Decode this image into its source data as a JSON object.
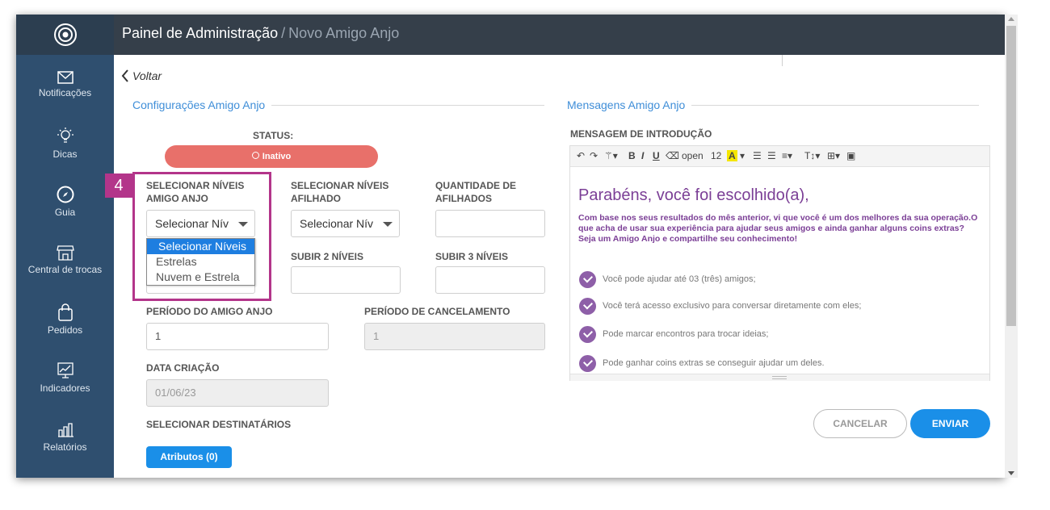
{
  "topbar": {
    "title": "Painel de Administração",
    "separator": "/",
    "subtitle": "Novo Amigo Anjo"
  },
  "sidebar": {
    "items": [
      {
        "label": "Notificações",
        "icon": "envelope-icon"
      },
      {
        "label": "Dicas",
        "icon": "lightbulb-icon"
      },
      {
        "label": "Guia",
        "icon": "compass-icon"
      },
      {
        "label": "Central de trocas",
        "icon": "store-icon"
      },
      {
        "label": "Pedidos",
        "icon": "shopping-bag-icon"
      },
      {
        "label": "Indicadores",
        "icon": "chart-icon"
      },
      {
        "label": "Relatórios",
        "icon": "report-icon"
      }
    ]
  },
  "back": {
    "label": "Voltar"
  },
  "config": {
    "section_title": "Configurações Amigo Anjo",
    "status_label": "STATUS:",
    "status_value": "Inativo",
    "niveis_amigo_label": "SELECIONAR NÍVEIS AMIGO ANJO",
    "niveis_amigo_value": "Selecionar Níveis",
    "niveis_afilhado_label": "SELECIONAR NÍVEIS AFILHADO",
    "niveis_afilhado_value": "Selecionar Níveis",
    "qtd_afilhados_label": "QUANTIDADE DE AFILHADOS",
    "qtd_afilhados_value": "",
    "subir2_label": "SUBIR 2 NÍVEIS",
    "subir3_label": "SUBIR 3 NÍVEIS",
    "periodo_label": "PERÍODO DO AMIGO ANJO",
    "periodo_value": "1",
    "cancelamento_label": "PERÍODO DE CANCELAMENTO",
    "cancelamento_value": "1",
    "data_label": "DATA CRIAÇÃO",
    "data_value": "01/06/23",
    "destinatarios_label": "SELECIONAR DESTINATÁRIOS",
    "atributos_button": "Atributos (0)",
    "dropdown_options": [
      "Selecionar Níveis",
      "Estrelas",
      "Nuvem e Estrela"
    ]
  },
  "annotation": {
    "step": "4",
    "color": "#b3358a"
  },
  "messages": {
    "section_title": "Mensagens Amigo Anjo",
    "intro_label": "MENSAGEM DE INTRODUÇÃO",
    "toolbar": {
      "font": "open",
      "size": "12"
    },
    "heading": "Parabéns, você foi escolhido(a),",
    "paragraph": "Com base nos seus resultados do mês anterior, vi que você é um dos melhores da sua operação.O que acha de usar sua experiência para ajudar seus amigos e ainda ganhar alguns coins extras? Seja um Amigo Anjo e compartilhe seu conhecimento!",
    "bullets": [
      "Você pode ajudar até 03 (três) amigos;",
      "Você terá acesso exclusivo para conversar diretamente com eles;",
      "Pode marcar encontros para trocar ideias;",
      "Pode ganhar coins extras se conseguir ajudar um deles."
    ]
  },
  "actions": {
    "cancel": "CANCELAR",
    "send": "ENVIAR"
  },
  "colors": {
    "accent": "#3f8ed8",
    "primary_button": "#1a8fe8",
    "status_inactive": "#e8706a",
    "message_purple": "#7b3f96"
  }
}
